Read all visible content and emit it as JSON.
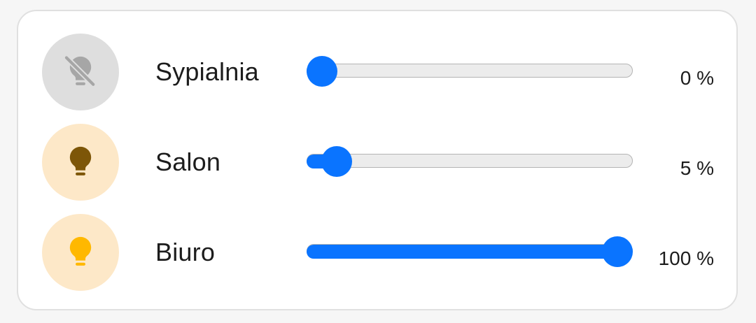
{
  "colors": {
    "accent": "#0a74ff",
    "off_icon_bg": "#dedede",
    "off_icon": "#a6a6a6",
    "on_icon_bg": "#fde8c8",
    "dim_bulb": "#7d5608",
    "bright_bulb": "#ffb800"
  },
  "lights": [
    {
      "name": "Sypialnia",
      "value_text": "0 %",
      "level": 0,
      "state": "off",
      "icon": "lightbulb-off-icon"
    },
    {
      "name": "Salon",
      "value_text": "5 %",
      "level": 5,
      "state": "on",
      "icon": "lightbulb-icon"
    },
    {
      "name": "Biuro",
      "value_text": "100 %",
      "level": 100,
      "state": "on",
      "icon": "lightbulb-icon"
    }
  ]
}
